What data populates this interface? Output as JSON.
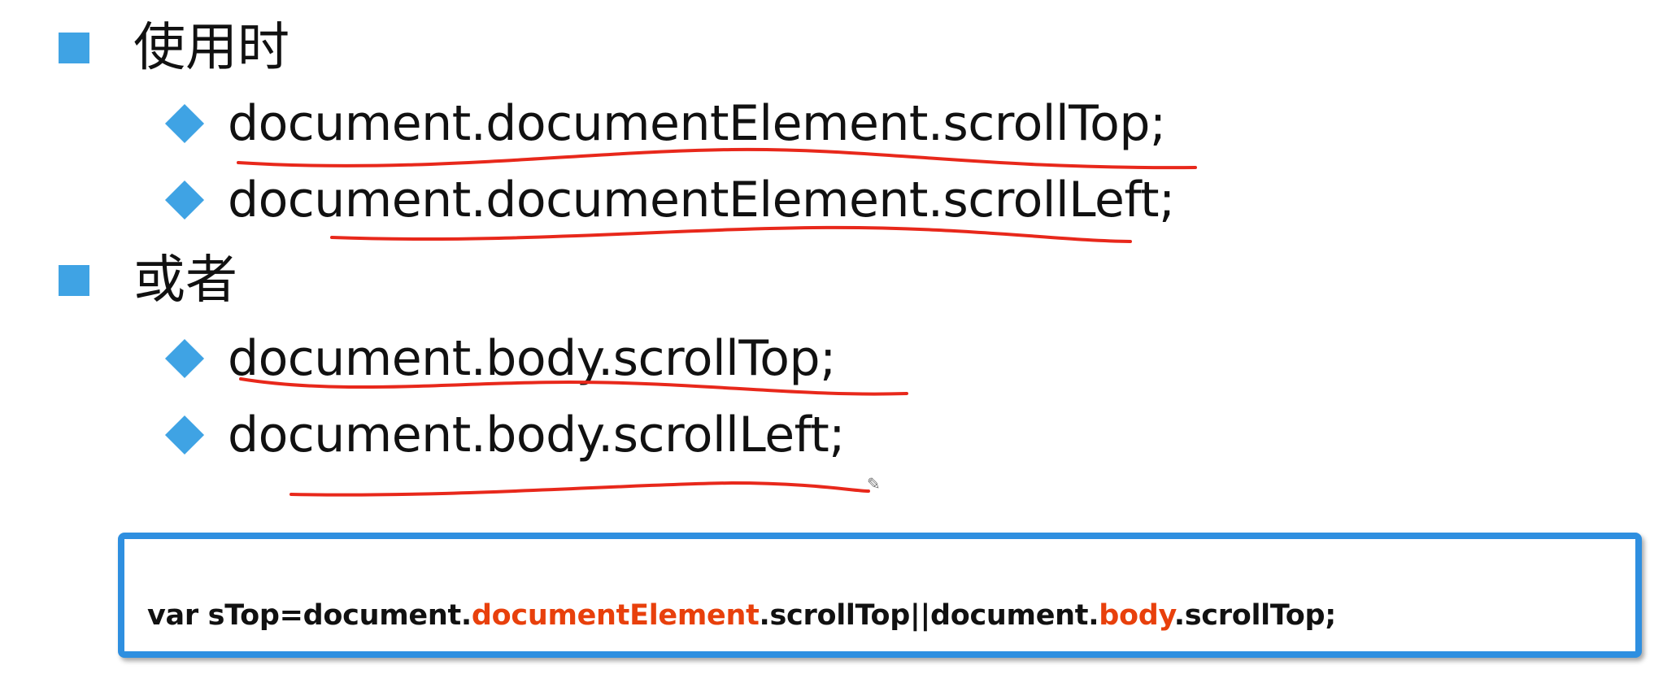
{
  "bullets": [
    {
      "heading": "使用时",
      "items": [
        "document.documentElement.scrollTop;",
        "document.documentElement.scrollLeft;"
      ]
    },
    {
      "heading": "或者",
      "items": [
        "document.body.scrollTop;",
        "document.body.scrollLeft;"
      ]
    }
  ],
  "code": {
    "part1": "var sTop=document.",
    "hl1": "documentElement",
    "part2": ".scrollTop||document.",
    "hl2": "body",
    "part3": ".scrollTop;"
  },
  "colors": {
    "bullet": "#3fa3e4",
    "underline": "#e8281b",
    "code_border": "#2e8fe0",
    "code_highlight": "#e8400c"
  },
  "icons": {
    "annotation_cursor": "pen-icon"
  }
}
